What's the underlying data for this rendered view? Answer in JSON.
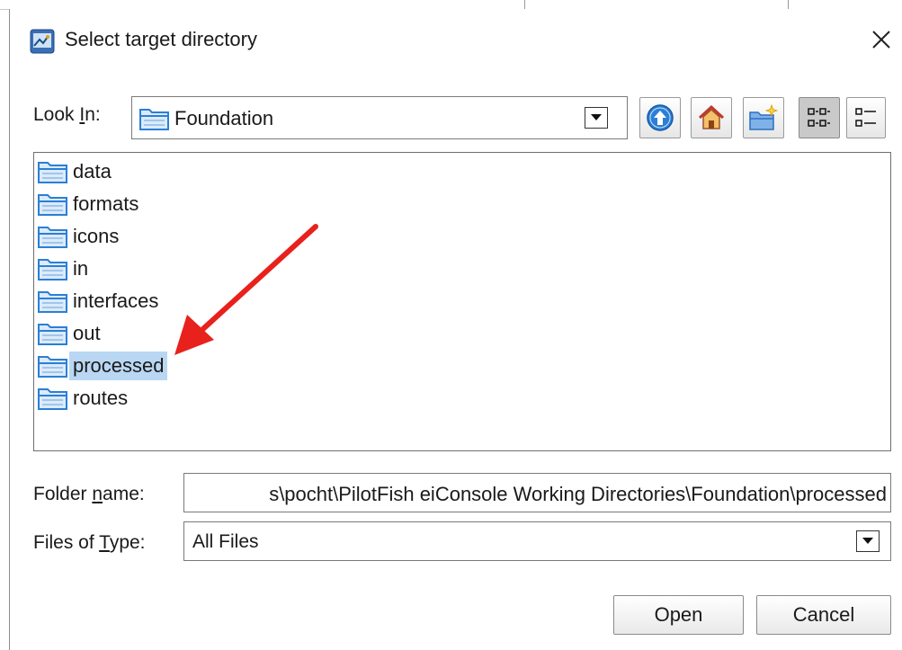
{
  "window": {
    "title": "Select target directory"
  },
  "look_in": {
    "label_prefix": "Look ",
    "label_mnemonic": "I",
    "label_suffix": "n:",
    "value": "Foundation"
  },
  "toolbar": [
    {
      "name": "up-one-level-icon"
    },
    {
      "name": "home-icon"
    },
    {
      "name": "new-folder-icon"
    },
    {
      "name": "list-view-icon"
    },
    {
      "name": "details-view-icon"
    }
  ],
  "files": [
    {
      "name": "data",
      "selected": false
    },
    {
      "name": "formats",
      "selected": false
    },
    {
      "name": "icons",
      "selected": false
    },
    {
      "name": "in",
      "selected": false
    },
    {
      "name": "interfaces",
      "selected": false
    },
    {
      "name": "out",
      "selected": false
    },
    {
      "name": "processed",
      "selected": true
    },
    {
      "name": "routes",
      "selected": false
    }
  ],
  "folder_name": {
    "label_prefix": "Folder ",
    "label_mnemonic": "n",
    "label_suffix": "ame:",
    "value": "s\\pocht\\PilotFish eiConsole Working Directories\\Foundation\\processed"
  },
  "files_of_type": {
    "label_prefix": "Files of ",
    "label_mnemonic": "T",
    "label_suffix": "ype:",
    "value": "All Files"
  },
  "buttons": {
    "open": "Open",
    "cancel": "Cancel"
  },
  "colors": {
    "selection": "#b9d7f3",
    "annotation_arrow": "#e8211d",
    "folder_blue": "#2b7fd6"
  }
}
